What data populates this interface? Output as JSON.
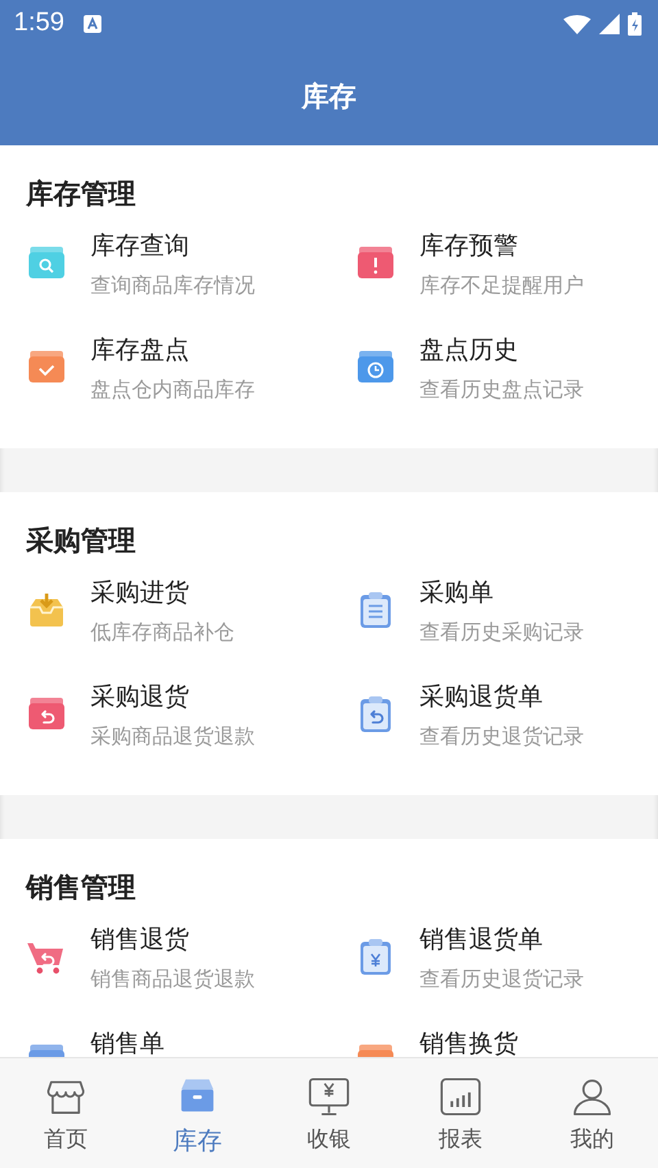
{
  "status_bar": {
    "time": "1:59"
  },
  "header": {
    "title": "库存"
  },
  "sections": [
    {
      "title": "库存管理",
      "items": [
        {
          "title": "库存查询",
          "subtitle": "查询商品库存情况"
        },
        {
          "title": "库存预警",
          "subtitle": "库存不足提醒用户"
        },
        {
          "title": "库存盘点",
          "subtitle": "盘点仓内商品库存"
        },
        {
          "title": "盘点历史",
          "subtitle": "查看历史盘点记录"
        }
      ]
    },
    {
      "title": "采购管理",
      "items": [
        {
          "title": "采购进货",
          "subtitle": "低库存商品补仓"
        },
        {
          "title": "采购单",
          "subtitle": "查看历史采购记录"
        },
        {
          "title": "采购退货",
          "subtitle": "采购商品退货退款"
        },
        {
          "title": "采购退货单",
          "subtitle": "查看历史退货记录"
        }
      ]
    },
    {
      "title": "销售管理",
      "items": [
        {
          "title": "销售退货",
          "subtitle": "销售商品退货退款"
        },
        {
          "title": "销售退货单",
          "subtitle": "查看历史退货记录"
        },
        {
          "title": "销售单"
        },
        {
          "title": "销售换货"
        }
      ]
    }
  ],
  "tab_bar": [
    {
      "label": "首页",
      "selected": false
    },
    {
      "label": "库存",
      "selected": true
    },
    {
      "label": "收银",
      "selected": false
    },
    {
      "label": "报表",
      "selected": false
    },
    {
      "label": "我的",
      "selected": false
    }
  ]
}
